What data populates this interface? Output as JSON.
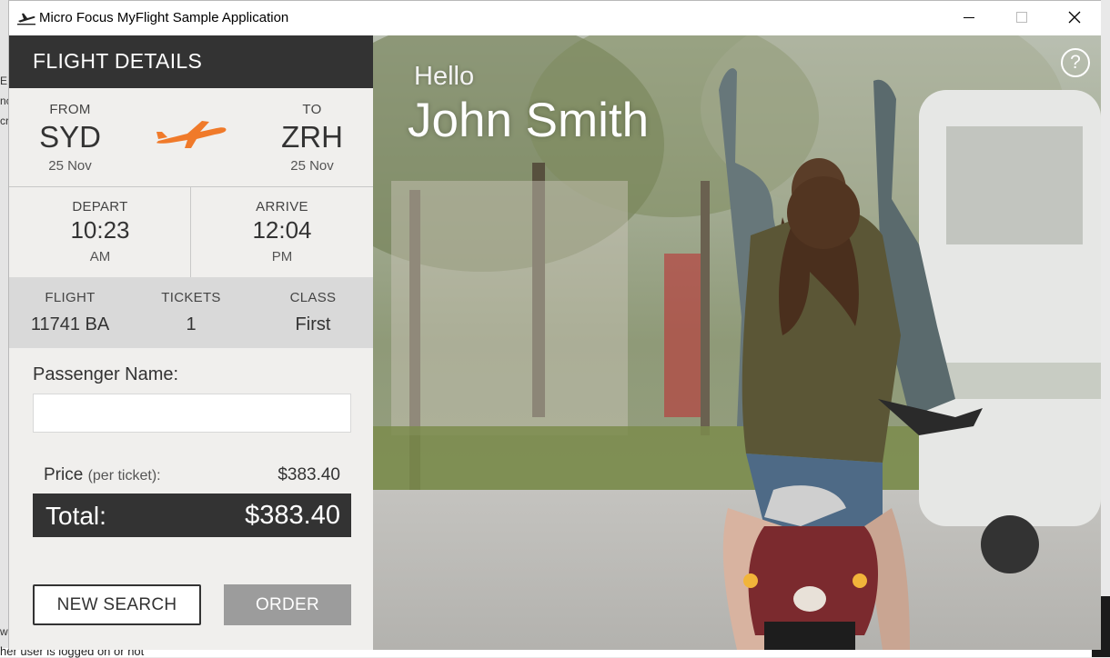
{
  "window": {
    "title": "Micro Focus MyFlight Sample Application",
    "min_glyph": "─",
    "max_glyph": "☐",
    "close_glyph": "✕"
  },
  "background": {
    "left_letters": [
      "E",
      "nc",
      "cr"
    ],
    "bottom_text": "her user is logged on or not",
    "bottom_left_char": "w"
  },
  "flight_details": {
    "header": "FLIGHT DETAILS",
    "from_label": "FROM",
    "from_code": "SYD",
    "from_date": "25 Nov",
    "to_label": "TO",
    "to_code": "ZRH",
    "to_date": "25 Nov",
    "depart_label": "DEPART",
    "depart_time": "10:23",
    "depart_ampm": "AM",
    "arrive_label": "ARRIVE",
    "arrive_time": "12:04",
    "arrive_ampm": "PM",
    "flight_label": "FLIGHT",
    "flight_value": "11741 BA",
    "tickets_label": "TICKETS",
    "tickets_value": "1",
    "class_label": "CLASS",
    "class_value": "First",
    "passenger_label": "Passenger Name:",
    "passenger_value": "",
    "price_label": "Price",
    "price_sub": "(per ticket):",
    "price_value": "$383.40",
    "total_label": "Total:",
    "total_value": "$383.40",
    "new_search_label": "NEW SEARCH",
    "order_label": "ORDER"
  },
  "greeting": {
    "hello": "Hello",
    "name": "John Smith",
    "help_glyph": "?"
  },
  "colors": {
    "dark": "#333333",
    "accent_orange": "#f07a2a",
    "disabled_button": "#9c9c9c"
  },
  "icons": {
    "app": "plane-takeoff-icon",
    "route": "airplane-icon",
    "help": "help-circle-icon"
  }
}
